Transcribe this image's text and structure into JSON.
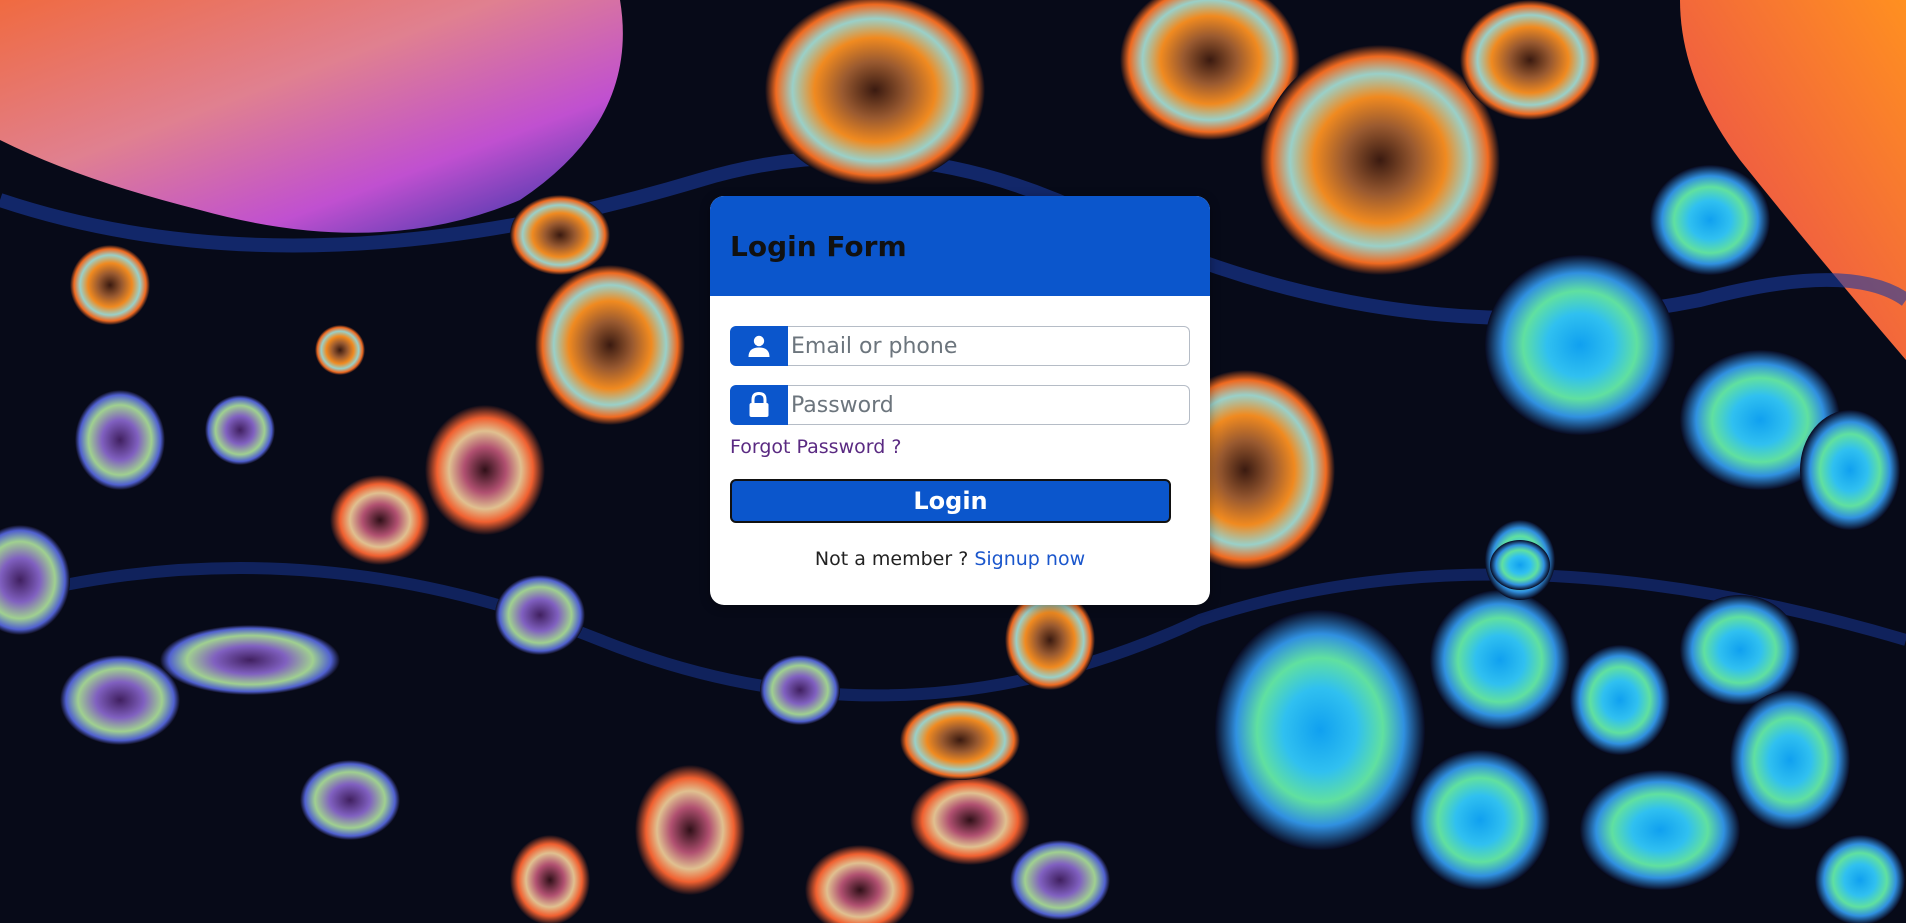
{
  "form": {
    "title": "Login Form",
    "email_placeholder": "Email or phone",
    "password_placeholder": "Password",
    "forgot_label": "Forgot Password ?",
    "login_label": "Login",
    "not_member_text": "Not a member ?",
    "signup_label": "Signup now"
  },
  "icons": {
    "email_addon": "user-icon",
    "password_addon": "lock-icon"
  },
  "colors": {
    "accent": "#0b56cc",
    "link": "#1a56cc",
    "visited_link": "#5a2a82",
    "card_bg": "#ffffff"
  }
}
